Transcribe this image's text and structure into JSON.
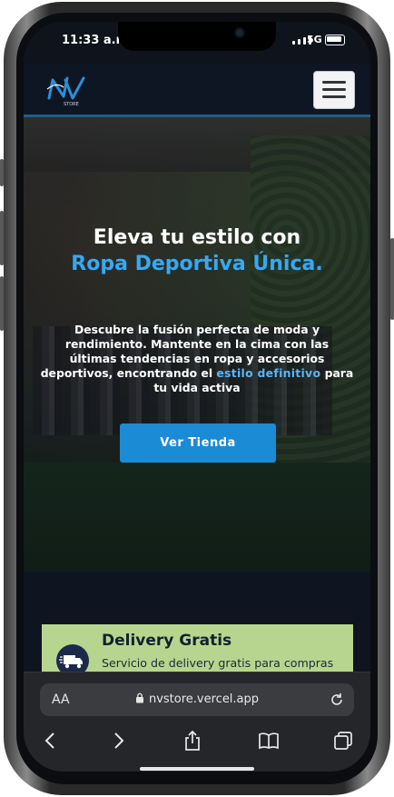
{
  "status_bar": {
    "time": "11:33 a.m.",
    "network": "5G"
  },
  "site": {
    "logo_text": "NV",
    "logo_subtext": "STORE"
  },
  "hero": {
    "title_line1": "Eleva tu estilo con",
    "title_line2": "Ropa Deportiva Única.",
    "desc_part1": "Descubre la fusión perfecta de moda y rendimiento. Mantente en la cima con las últimas tendencias en ropa y accesorios deportivos, encontrando el ",
    "desc_highlight": "estilo definitivo",
    "desc_part2": " para tu vida activa",
    "cta_label": "Ver Tienda"
  },
  "delivery": {
    "title": "Delivery Gratis",
    "text": "Servicio de delivery gratis para compras"
  },
  "browser": {
    "text_size_label": "AA",
    "url": "nvstore.vercel.app"
  },
  "colors": {
    "accent_blue": "#1b8bd6",
    "highlight_blue": "#38a8f2",
    "card_green": "#b7d58e",
    "header_bg": "#0f1623"
  },
  "icons": [
    "signal-icon",
    "battery-icon",
    "menu-icon",
    "truck-icon",
    "lock-icon",
    "reload-icon",
    "back-icon",
    "forward-icon",
    "share-icon",
    "bookmarks-icon",
    "tabs-icon"
  ]
}
